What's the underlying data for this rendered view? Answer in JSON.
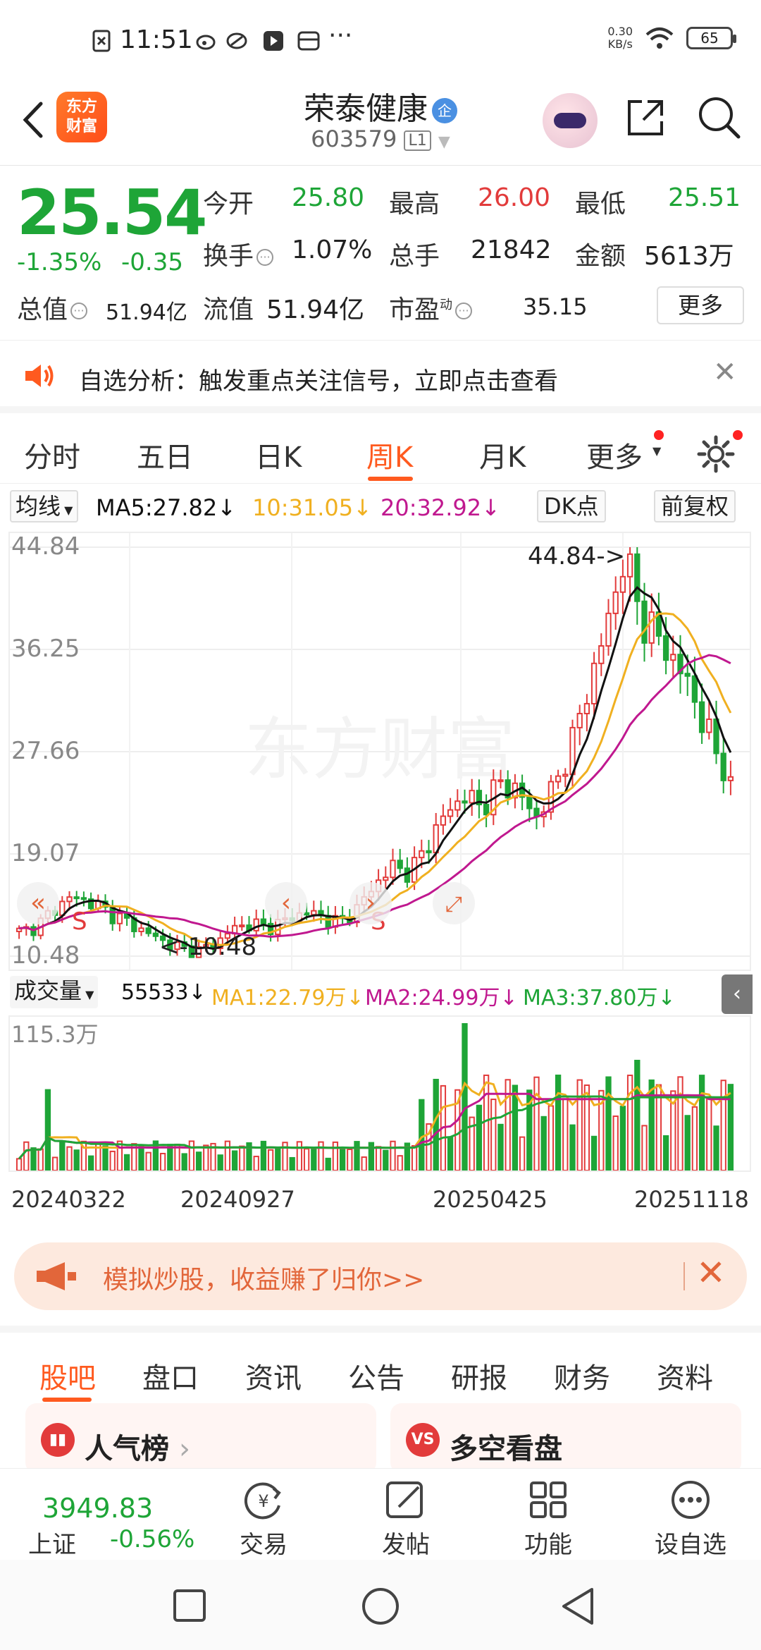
{
  "status_bar": {
    "time": "11:51",
    "net_speed_value": "0.30",
    "net_speed_unit": "KB/s",
    "battery": "65"
  },
  "header": {
    "logo_line1": "东方",
    "logo_line2": "财富",
    "stock_name": "荣泰健康",
    "enterprise_badge": "企",
    "stock_code": "603579",
    "level_badge": "L1"
  },
  "quote": {
    "price": "25.54",
    "change_pct": "-1.35%",
    "change_amt": "-0.35",
    "open_label": "今开",
    "open": "25.80",
    "high_label": "最高",
    "high": "26.00",
    "low_label": "最低",
    "low": "25.51",
    "turnover_label": "换手",
    "turnover": "1.07%",
    "volume_label": "总手",
    "volume": "21842",
    "amount_label": "金额",
    "amount": "5613万",
    "total_cap_label": "总值",
    "total_cap": "51.94亿",
    "float_cap_label": "流值",
    "float_cap": "51.94亿",
    "pe_label": "市盈",
    "pe_sup": "动",
    "pe": "35.15",
    "more": "更多"
  },
  "notice": {
    "text": "自选分析：触发重点关注信号，立即点击查看"
  },
  "ktabs": {
    "items": [
      "分时",
      "五日",
      "日K",
      "周K",
      "月K",
      "更多"
    ],
    "active": "周K"
  },
  "ma_legend": {
    "selector": "均线",
    "ma5": "MA5:27.82",
    "ma10": "10:31.05",
    "ma20": "20:32.92",
    "dk": "DK点",
    "adjust": "前复权"
  },
  "price_axis": [
    "44.84",
    "36.25",
    "27.66",
    "19.07",
    "10.48"
  ],
  "annotations": {
    "high": "44.84->",
    "low": "<-10.48",
    "sell_marker": "S"
  },
  "volume_legend": {
    "selector": "成交量",
    "vol": "55533",
    "ma1": "MA1:22.79万",
    "ma2": "MA2:24.99万",
    "ma3": "MA3:37.80万",
    "axis_max": "115.3万"
  },
  "dates": [
    "20240322",
    "20240927",
    "20250425",
    "20251118"
  ],
  "promo": {
    "text": "模拟炒股，收益赚了归你>>"
  },
  "bottom_tabs": {
    "items": [
      "股吧",
      "盘口",
      "资讯",
      "公告",
      "研报",
      "财务",
      "资料"
    ],
    "active": "股吧"
  },
  "cards": {
    "left": "人气榜",
    "right": "多空看盘",
    "right_badge": "VS"
  },
  "bottom_nav": {
    "index_value": "3949.83",
    "index_name": "上证",
    "index_change": "-0.56%",
    "items": [
      "交易",
      "发帖",
      "功能",
      "设自选"
    ]
  },
  "colors": {
    "up": "#e23b3b",
    "down": "#1ea537",
    "accent": "#ff5a1f",
    "ma5": "#111111",
    "ma10": "#f0b020",
    "ma20": "#c0188f"
  },
  "chart_data": {
    "type": "candlestick",
    "title": "",
    "ylim": [
      10.48,
      44.84
    ],
    "weekly_close_approx": [
      12.5,
      13.0,
      14.5,
      15.5,
      15.0,
      14.2,
      13.4,
      12.6,
      11.8,
      11.2,
      10.9,
      11.5,
      12.8,
      13.2,
      12.9,
      13.5,
      14.2,
      13.8,
      13.2,
      14.5,
      16.5,
      18.0,
      17.5,
      20.0,
      22.5,
      24.0,
      23.0,
      25.0,
      24.5,
      22.0,
      24.5,
      28.0,
      33.0,
      38.0,
      44.0,
      39.0,
      37.0,
      35.0,
      32.0,
      28.0,
      25.54
    ],
    "ma5_last": 27.82,
    "ma10_last": 31.05,
    "ma20_last": 32.92
  }
}
